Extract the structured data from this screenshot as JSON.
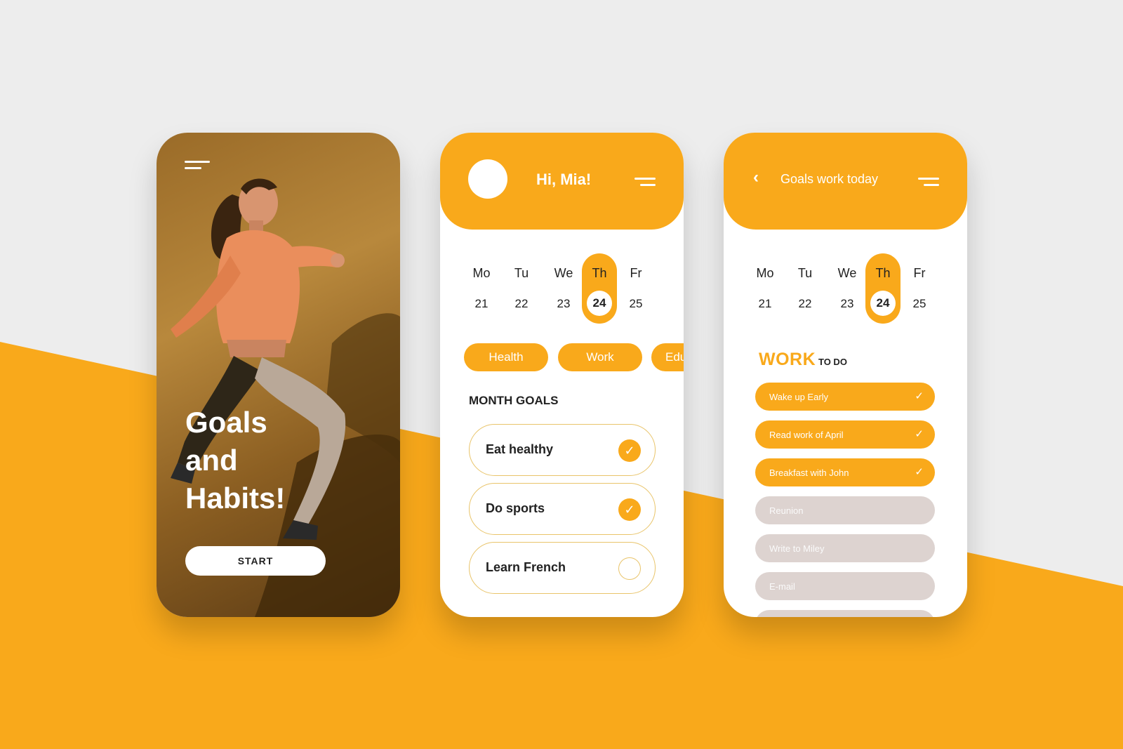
{
  "colors": {
    "accent": "#f9a91b",
    "background": "#ededed",
    "pending": "#ddd3d0",
    "outline": "#e9c46a"
  },
  "splash": {
    "menu_icon": "menu-icon",
    "hero_lines": [
      "Goals",
      "and",
      "Habits!"
    ],
    "start_label": "START"
  },
  "home": {
    "greeting": "Hi, Mia!",
    "menu_icon": "menu-icon",
    "days": [
      {
        "name": "Mo",
        "date": "21"
      },
      {
        "name": "Tu",
        "date": "22"
      },
      {
        "name": "We",
        "date": "23"
      },
      {
        "name": "Th",
        "date": "24",
        "selected": true
      },
      {
        "name": "Fr",
        "date": "25"
      }
    ],
    "categories": [
      "Health",
      "Work",
      "Edu"
    ],
    "section_title": "MONTH GOALS",
    "goals": [
      {
        "label": "Eat healthy",
        "done": true
      },
      {
        "label": "Do sports",
        "done": true
      },
      {
        "label": "Learn French",
        "done": false
      }
    ]
  },
  "work": {
    "back_icon": "chevron-left-icon",
    "title": "Goals work today",
    "menu_icon": "menu-icon",
    "days": [
      {
        "name": "Mo",
        "date": "21"
      },
      {
        "name": "Tu",
        "date": "22"
      },
      {
        "name": "We",
        "date": "23"
      },
      {
        "name": "Th",
        "date": "24",
        "selected": true
      },
      {
        "name": "Fr",
        "date": "25"
      }
    ],
    "heading": "WORK",
    "subheading": "TO DO",
    "todos": [
      {
        "label": "Wake up Early",
        "done": true
      },
      {
        "label": "Read work of April",
        "done": true
      },
      {
        "label": "Breakfast with John",
        "done": true
      },
      {
        "label": "Reunion",
        "done": false
      },
      {
        "label": "Write to Miley",
        "done": false
      },
      {
        "label": "E-mail",
        "done": false
      }
    ]
  }
}
